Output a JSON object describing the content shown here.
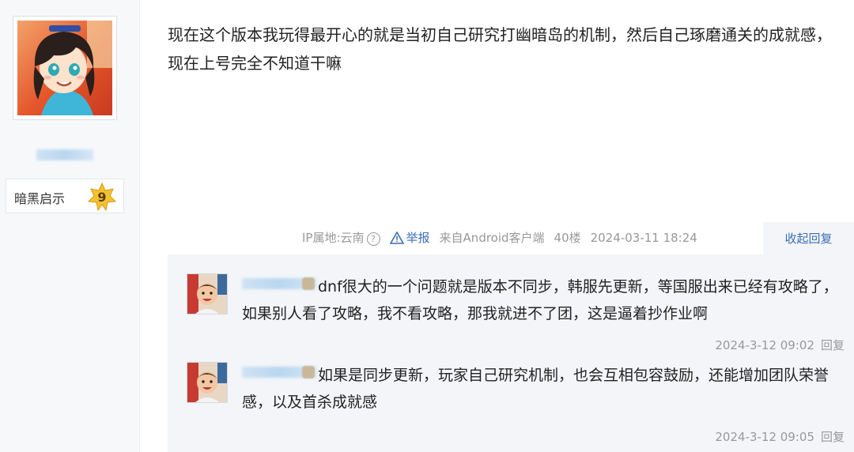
{
  "post": {
    "content": "现在这个版本我玩得最开心的就是当初自己研究打幽暗岛的机制，然后自己琢磨通关的成就感，现在上号完全不知道干嘛",
    "badge_label": "暗黑启示",
    "badge_level": "9",
    "ip_location": "IP属地:云南",
    "report_label": "举报",
    "source": "来自Android客户端",
    "floor": "40楼",
    "timestamp": "2024-03-11 18:24",
    "collapse_label": "收起回复"
  },
  "replies": [
    {
      "text": "dnf很大的一个问题就是版本不同步，韩服先更新，等国服出来已经有攻略了，如果别人看了攻略，我不看攻略，那我就进不了团，这是逼着抄作业啊",
      "time": "2024-3-12 09:02",
      "reply_label": "回复"
    },
    {
      "text": "如果是同步更新，玩家自己研究机制，也会互相包容鼓励，还能增加团队荣誉感，以及首杀成就感",
      "time": "2024-3-12 09:05",
      "reply_label": "回复"
    }
  ],
  "colors": {
    "link": "#3b6fb6",
    "meta": "#999999",
    "reply_bg": "#f3f5f8"
  },
  "icons": [
    "anime-avatar",
    "level-star-icon",
    "help-circle-icon",
    "warning-triangle-icon",
    "baby-avatar"
  ]
}
